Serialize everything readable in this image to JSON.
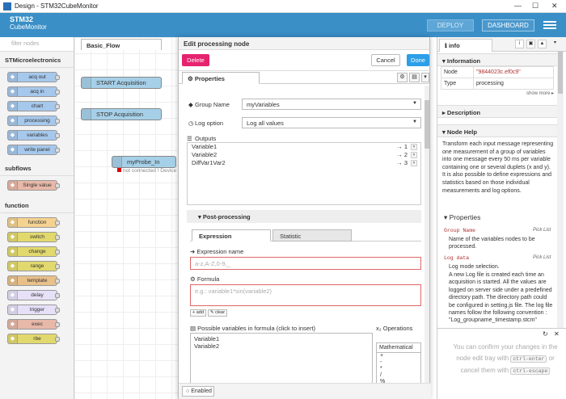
{
  "window": {
    "title": "Design - STM32CubeMonitor"
  },
  "header": {
    "logo_line1": "STM32",
    "logo_line2": "CubeMonitor",
    "deploy_label": "DEPLOY",
    "dashboard_label": "DASHBOARD"
  },
  "palette": {
    "filter_placeholder": "filter nodes",
    "categories": {
      "stmicro": "STMicroelectronics",
      "subflows": "subflows",
      "function": "function"
    },
    "stmicro_nodes": [
      "acq out",
      "acq in",
      "chart",
      "processing",
      "variables",
      "write panel"
    ],
    "subflow_nodes": [
      "Single value"
    ],
    "function_nodes": [
      "function",
      "switch",
      "change",
      "range",
      "template",
      "delay",
      "trigger",
      "exec",
      "rbe"
    ]
  },
  "workspace": {
    "tab": "Basic_Flow",
    "nodes": [
      "START Acquisition",
      "STOP Acquisition",
      "myProbe_In"
    ],
    "status": "not connected ! Device n"
  },
  "tray": {
    "title": "Edit processing node",
    "delete_label": "Delete",
    "cancel_label": "Cancel",
    "done_label": "Done",
    "properties_tab": "Properties",
    "group_name_label": "Group Name",
    "group_name_value": "myVariables",
    "log_option_label": "Log option",
    "log_option_value": "Log all values",
    "outputs_label": "Outputs",
    "outputs": [
      {
        "name": "Variable1",
        "num": "→ 1"
      },
      {
        "name": "Variable2",
        "num": "→ 2"
      },
      {
        "name": "DiffVar1Var2",
        "num": "→ 3"
      }
    ],
    "postprocessing_label": "Post-processing",
    "tab_expression": "Expression",
    "tab_statistic": "Statistic",
    "expression_name_label": "Expression name",
    "expression_name_placeholder": "a-z,A-Z,0-9,_",
    "formula_label": "Formula",
    "formula_placeholder": "e.g.: variable1*sin(variable2)",
    "add_label": "add",
    "clear_label": "clear",
    "possible_vars_label": "Possible variables in formula (click to insert)",
    "possible_vars": [
      "Variable1",
      "Variable2"
    ],
    "operations_label": "Operations",
    "operations_select": "Mathematical",
    "operations": [
      "+",
      "-",
      "*",
      "/",
      "%"
    ],
    "enabled_label": "Enabled"
  },
  "sidebar": {
    "info_tab": "info",
    "information_title": "Information",
    "node_key": "Node",
    "node_value": "\"9844023c.ef0c9\"",
    "type_key": "Type",
    "type_value": "processing",
    "show_more": "show more",
    "description_title": "Description",
    "node_help_title": "Node Help",
    "help_text": "Transform each input message representing one measurement of a group of variables into one message every 50 ms per variable containing one or several duplets (x and y). It is also possible to define expressions and statistics based on those individual measurements and log options.",
    "properties_title": "Properties",
    "prop1_name": "Group Name",
    "prop1_type": "Pick List",
    "prop1_desc": "Name of the variables nodes to be processed.",
    "prop2_name": "Log data",
    "prop2_type": "Pick List",
    "prop2_desc": "Log mode selection.",
    "prop2_more": "A new Log file is created each time an acquisition is started. All the values are logged on server side under a predefined directory path. The directory path could be configured in setting.js file. The log file names follow the following convention : \"Log_groupname_timestamp.stcm\"",
    "confirm_pre": "You can confirm your changes in the node edit tray with",
    "confirm_key1": "ctrl-enter",
    "confirm_mid": "or cancel them with",
    "confirm_key2": "ctrl-escape"
  }
}
